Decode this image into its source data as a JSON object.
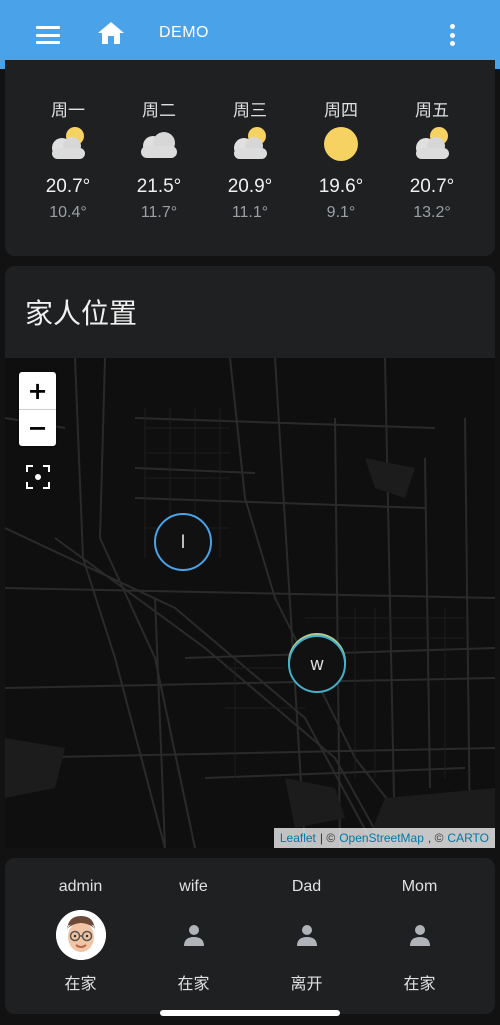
{
  "appbar": {
    "menu_icon": "menu-icon",
    "home_icon": "home-icon",
    "tab_label": "DEMO",
    "overflow_icon": "more-vert-icon",
    "color": "#4aa3e8"
  },
  "forecast": [
    {
      "day": "周一",
      "icon": "partly-cloudy",
      "high": "20.7°",
      "low": "10.4°"
    },
    {
      "day": "周二",
      "icon": "cloudy",
      "high": "21.5°",
      "low": "11.7°"
    },
    {
      "day": "周三",
      "icon": "partly-cloudy",
      "high": "20.9°",
      "low": "11.1°"
    },
    {
      "day": "周四",
      "icon": "sunny",
      "high": "19.6°",
      "low": "9.1°"
    },
    {
      "day": "周五",
      "icon": "partly-cloudy",
      "high": "20.7°",
      "low": "13.2°"
    }
  ],
  "map": {
    "title": "家人位置",
    "zoom_in": "+",
    "zoom_out": "−",
    "fit_icon": "fit-bounds-icon",
    "markers": [
      {
        "label": "l"
      },
      {
        "label": "w"
      }
    ],
    "attribution": {
      "leaflet": "Leaflet",
      "sep": "| ©",
      "osm": "OpenStreetMap",
      "comma": ", ©",
      "carto": "CARTO"
    }
  },
  "people": [
    {
      "name": "admin",
      "avatar": "memoji-avatar",
      "status": "在家"
    },
    {
      "name": "wife",
      "avatar": "person-icon",
      "status": "在家"
    },
    {
      "name": "Dad",
      "avatar": "person-icon",
      "status": "离开"
    },
    {
      "name": "Mom",
      "avatar": "person-icon",
      "status": "在家"
    }
  ]
}
